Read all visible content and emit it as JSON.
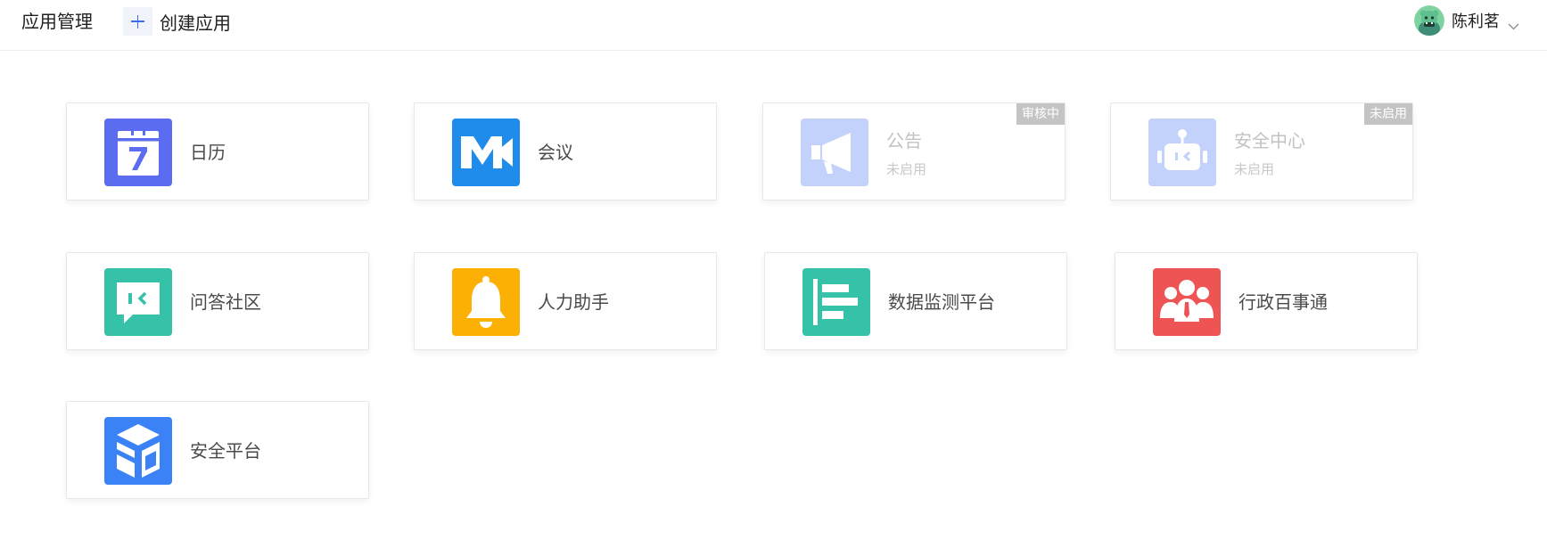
{
  "header": {
    "title": "应用管理",
    "create_label": "创建应用",
    "user_name": "陈利茗"
  },
  "colors": {
    "calendar": "#5b6cf0",
    "meeting": "#1f8ceb",
    "notice": "#3c6cf0",
    "security_center": "#3c6cf0",
    "qa_community": "#35c2a8",
    "hr_assistant": "#fbb003",
    "data_monitor": "#35c2a8",
    "admin_affairs": "#ee5454",
    "security_platform": "#3b82f6",
    "badge": "#c4c4c4"
  },
  "apps": [
    {
      "name": "日历",
      "icon": "calendar-icon"
    },
    {
      "name": "会议",
      "icon": "meeting-icon"
    },
    {
      "name": "公告",
      "icon": "megaphone-icon",
      "status": "未启用",
      "badge": "审核中"
    },
    {
      "name": "安全中心",
      "icon": "robot-icon",
      "status": "未启用",
      "badge": "未启用"
    },
    {
      "name": "问答社区",
      "icon": "chat-bubble-icon"
    },
    {
      "name": "人力助手",
      "icon": "bell-icon"
    },
    {
      "name": "数据监测平台",
      "icon": "bar-chart-icon"
    },
    {
      "name": "行政百事通",
      "icon": "people-group-icon"
    },
    {
      "name": "安全平台",
      "icon": "cube-icon"
    }
  ]
}
